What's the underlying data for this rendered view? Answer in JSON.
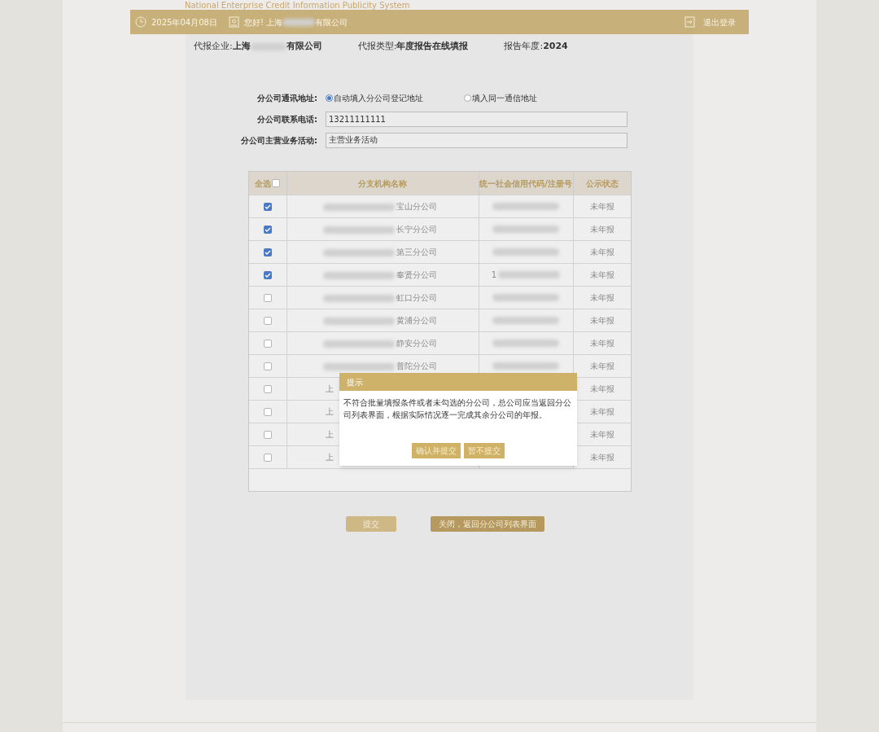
{
  "site_title": "National Enterprise Credit Information Publicity System",
  "top_bar": {
    "date": "2025年04月08日",
    "greeting_prefix": "您好! 上海",
    "greeting_suffix": "有限公司",
    "logout": "退出登录"
  },
  "summary": [
    {
      "label": "代报企业:",
      "value_prefix": "上海",
      "value_suffix": "有限公司"
    },
    {
      "label": "代报类型:",
      "value_prefix": "年度报告在线填报"
    },
    {
      "label": "报告年度:",
      "value_prefix": "2024"
    }
  ],
  "address": {
    "label": "分公司通讯地址:",
    "options": [
      {
        "label": "自动填入分公司登记地址",
        "selected": true
      },
      {
        "label": "填入同一通信地址",
        "selected": false
      }
    ]
  },
  "fields": [
    {
      "label": "分公司联系电话:",
      "value": "13211111111"
    },
    {
      "label": "分公司主营业务活动:",
      "value": "主营业务活动"
    }
  ],
  "table": {
    "select_all": {
      "label": "全选",
      "checked": false
    },
    "columns": [
      "分支机构名称",
      "统一社会信用代码/注册号",
      "公示状态"
    ],
    "rows": [
      {
        "checked": true,
        "name": "宝山分公司",
        "status": "未年报"
      },
      {
        "checked": true,
        "name": "长宁分公司",
        "status": "未年报"
      },
      {
        "checked": true,
        "name": "第三分公司",
        "status": "未年报"
      },
      {
        "checked": true,
        "name": "奉贤分公司",
        "code": "1",
        "status": "未年报"
      },
      {
        "checked": false,
        "name": "虹口分公司",
        "status": "未年报"
      },
      {
        "checked": false,
        "name": "黄浦分公司",
        "status": "未年报"
      },
      {
        "checked": false,
        "name": "静安分公司",
        "status": "未年报"
      },
      {
        "checked": false,
        "name": "普陀分公司",
        "status": "未年报"
      },
      {
        "checked": false,
        "prefix": "上",
        "status": "未年报"
      },
      {
        "checked": false,
        "prefix": "上",
        "status": "未年报"
      },
      {
        "checked": false,
        "prefix": "上",
        "status": "未年报"
      },
      {
        "checked": false,
        "prefix": "上",
        "status": "未年报"
      }
    ]
  },
  "buttons": [
    {
      "label": "提交",
      "kind": "light"
    },
    {
      "label": "关闭，返回分公司列表界面",
      "kind": "dark"
    }
  ],
  "dialog": {
    "title": "提示",
    "message": "不符合批量填报条件或者未勾选的分公司，总公司应当返回分公司列表界面，根据实际情况逐一完成其余分公司的年报。",
    "buttons": [
      "确认并提交",
      "暂不提交"
    ]
  }
}
